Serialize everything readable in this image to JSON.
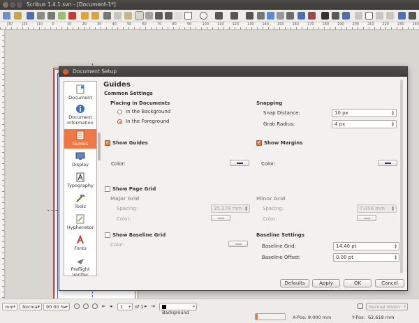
{
  "window": {
    "title": "Scribus 1.4.1.svn - [Document-1*]"
  },
  "ruler": {
    "labels": [
      "|30",
      "|20",
      "|10",
      "0",
      "10",
      "20",
      "30",
      "40",
      "50",
      "60",
      "70",
      "80",
      "90",
      "100",
      "110",
      "120",
      "130",
      "140",
      "150",
      "160",
      "170",
      "180",
      "190",
      "200",
      "210",
      "220",
      "230",
      "240"
    ]
  },
  "dialog": {
    "title": "Document Setup",
    "nav": [
      {
        "label": "Document",
        "icon": "document-icon"
      },
      {
        "label": "Document Information",
        "icon": "info-icon"
      },
      {
        "label": "Guides",
        "icon": "guides-icon",
        "active": true
      },
      {
        "label": "Display",
        "icon": "display-icon"
      },
      {
        "label": "Typography",
        "icon": "typography-icon"
      },
      {
        "label": "Tools",
        "icon": "tools-icon"
      },
      {
        "label": "Hyphenator",
        "icon": "hyphenator-icon"
      },
      {
        "label": "Fonts",
        "icon": "fonts-icon"
      },
      {
        "label": "Preflight Verifier",
        "icon": "preflight-icon"
      }
    ],
    "heading": "Guides",
    "common_settings": "Common Settings",
    "placing": {
      "label": "Placing in Documents",
      "option_background": "In the Background",
      "option_foreground": "In the Foreground",
      "selected": "In the Foreground"
    },
    "snapping": {
      "label": "Snapping",
      "snap_distance_label": "Snap Distance:",
      "snap_distance_value": "10 px",
      "grab_radius_label": "Grab Radius:",
      "grab_radius_value": "4  px"
    },
    "show_guides": {
      "label": "Show Guides",
      "checked": true,
      "color_label": "Color:"
    },
    "show_margins": {
      "label": "Show Margins",
      "checked": true,
      "color_label": "Color:"
    },
    "page_grid": {
      "label": "Show Page Grid",
      "checked": false,
      "major": "Major Grid",
      "minor": "Minor Grid",
      "spacing_label": "Spacing:",
      "color_label": "Color:",
      "major_spacing": "35.278 mm",
      "minor_spacing": "7.056 mm"
    },
    "baseline_grid": {
      "label": "Show Baseline Grid",
      "checked": false,
      "color_label": "Color:"
    },
    "baseline_settings": {
      "label": "Baseline Settings",
      "grid_label": "Baseline Grid:",
      "grid_value": "14.40 pt",
      "offset_label": "Baseline Offset:",
      "offset_value": "0.00 pt"
    },
    "buttons": {
      "defaults": "Defaults",
      "apply": "Apply",
      "ok": "OK",
      "cancel": "Cancel"
    }
  },
  "statusbar": {
    "unit": "mm",
    "mode": "Normal",
    "zoom": "90.00 %",
    "page": "1",
    "page_of": "of 1",
    "layer": "Background",
    "vision": "Normal Vision",
    "xpos_label": "X-Pos:",
    "xpos": "8.000 mm",
    "ypos_label": "Y-Pos:",
    "ypos": "62.618 mm",
    "progress": 0.08
  },
  "colors": {
    "accent": "#f07746",
    "guide": "#4c67c7",
    "bleed": "#d63333",
    "swatch": "#2a2e7a"
  }
}
